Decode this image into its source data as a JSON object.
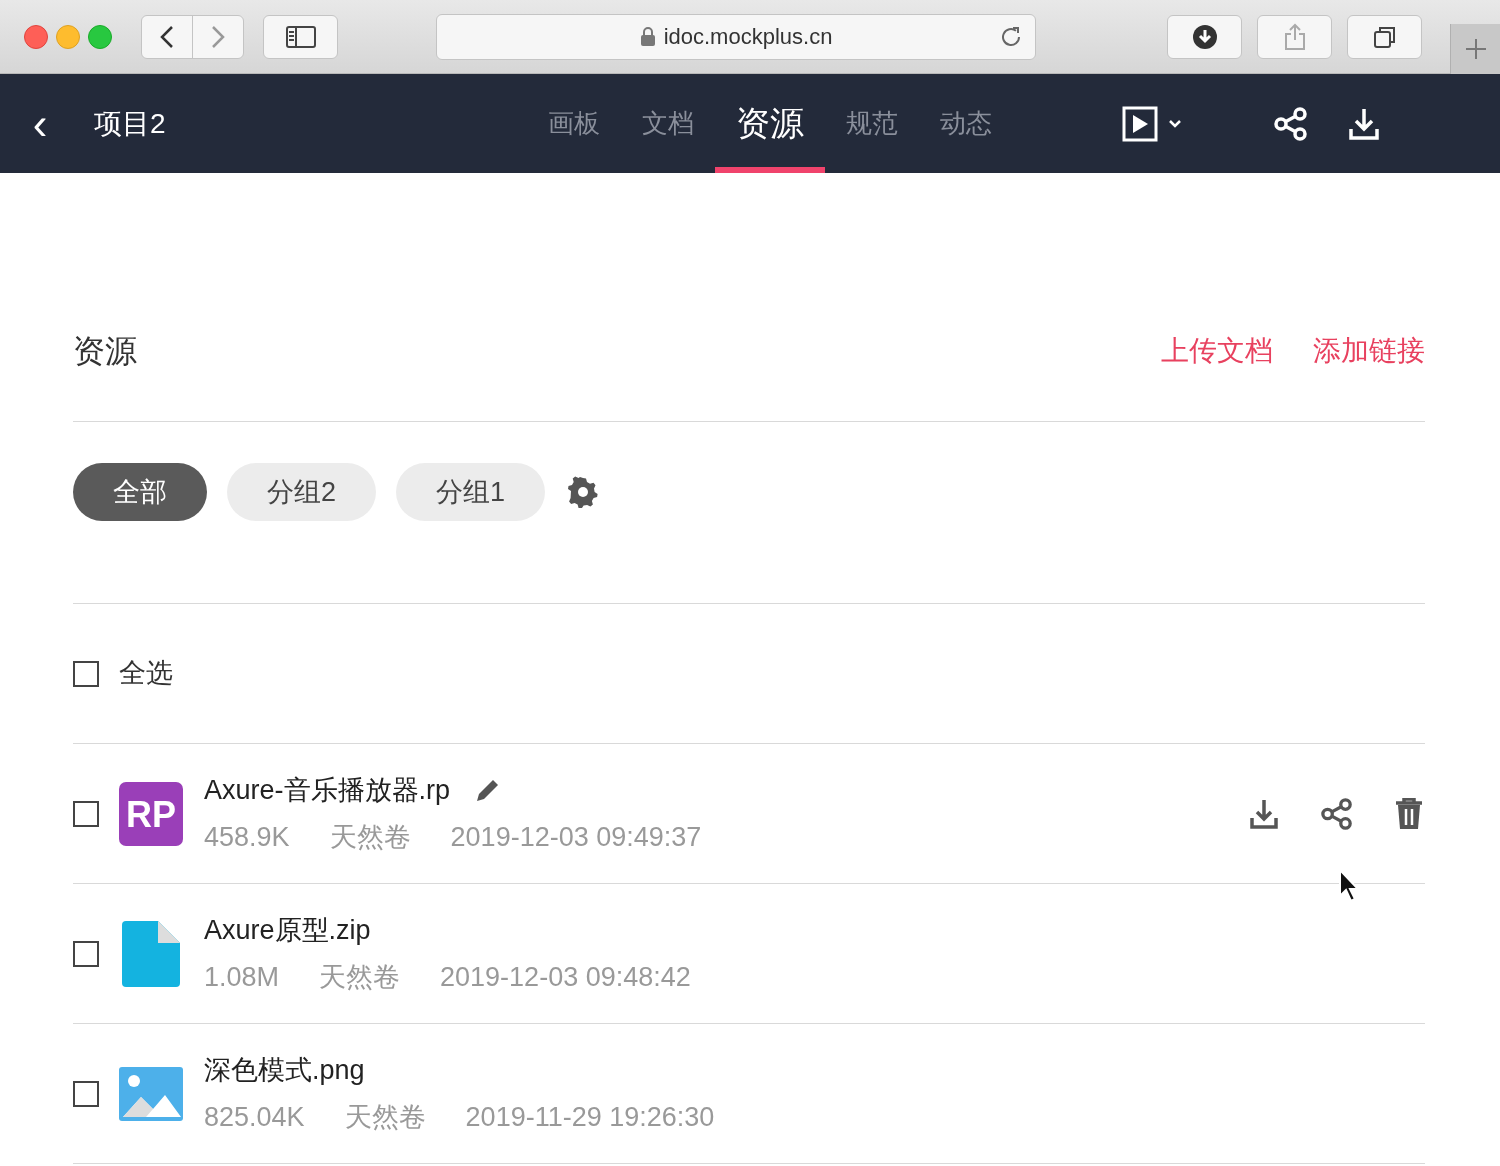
{
  "browser": {
    "url": "idoc.mockplus.cn"
  },
  "nav": {
    "back": "‹",
    "project": "项目2",
    "tabs": [
      {
        "label": "画板",
        "selected": false
      },
      {
        "label": "文档",
        "selected": false
      },
      {
        "label": "资源",
        "selected": true
      },
      {
        "label": "规范",
        "selected": false
      },
      {
        "label": "动态",
        "selected": false
      }
    ]
  },
  "section": {
    "title": "资源",
    "actions": [
      "上传文档",
      "添加链接"
    ]
  },
  "groups": [
    {
      "label": "全部",
      "selected": true
    },
    {
      "label": "分组2",
      "selected": false
    },
    {
      "label": "分组1",
      "selected": false
    }
  ],
  "select_all": {
    "label": "全选",
    "checked": false
  },
  "files": [
    {
      "kind": "rp",
      "badge": "RP",
      "name": "Axure-音乐播放器.rp",
      "size": "458.9K",
      "owner": "天然卷",
      "time": "2019-12-03 09:49:37",
      "checked": false,
      "hovered": true
    },
    {
      "kind": "file",
      "name": "Axure原型.zip",
      "size": "1.08M",
      "owner": "天然卷",
      "time": "2019-12-03 09:48:42",
      "checked": false,
      "hovered": false
    },
    {
      "kind": "image",
      "name": "深色模式.png",
      "size": "825.04K",
      "owner": "天然卷",
      "time": "2019-11-29 19:26:30",
      "checked": false,
      "hovered": false
    }
  ]
}
